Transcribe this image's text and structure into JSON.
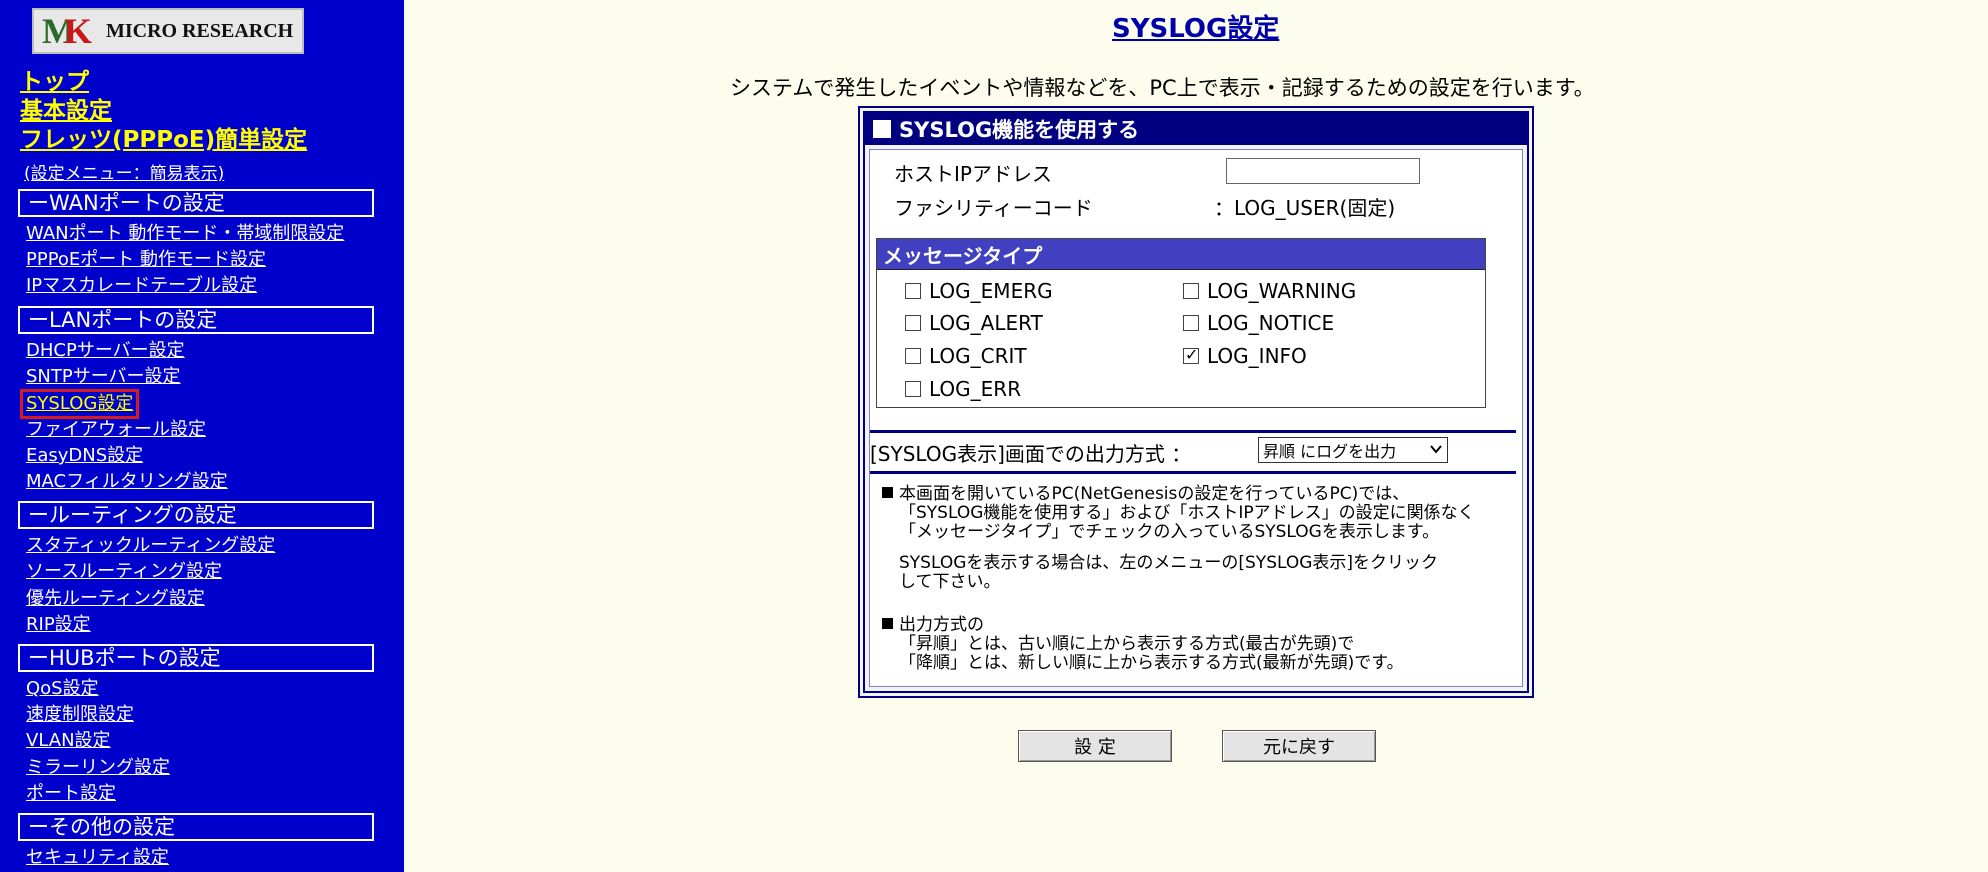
{
  "sidebar": {
    "logo_text": "MICRO RESEARCH",
    "top_links": [
      "トップ",
      "基本設定",
      "フレッツ(PPPoE)簡単設定"
    ],
    "menu_mode": "(設定メニュー：簡易表示)",
    "sections": [
      {
        "title": "ーWANポートの設定",
        "items": [
          "WANポート 動作モード・帯域制限設定",
          "PPPoEポート 動作モード設定",
          "IPマスカレードテーブル設定"
        ]
      },
      {
        "title": "ーLANポートの設定",
        "items": [
          "DHCPサーバー設定",
          "SNTPサーバー設定",
          "SYSLOG設定",
          "ファイアウォール設定",
          "EasyDNS設定",
          "MACフィルタリング設定"
        ]
      },
      {
        "title": "ールーティングの設定",
        "items": [
          "スタティックルーティング設定",
          "ソースルーティング設定",
          "優先ルーティング設定",
          "RIP設定"
        ]
      },
      {
        "title": "ーHUBポートの設定",
        "items": [
          "QoS設定",
          "速度制限設定",
          "VLAN設定",
          "ミラーリング設定",
          "ポート設定"
        ]
      },
      {
        "title": "ーその他の設定",
        "items": [
          "セキュリティ設定"
        ]
      }
    ]
  },
  "main": {
    "title": "SYSLOG設定",
    "description": "システムで発生したイベントや情報などを、PC上で表示・記録するための設定を行います。",
    "panel": {
      "enable_label": "SYSLOG機能を使用する",
      "enable_checked": false,
      "host_ip_label": "ホストIPアドレス",
      "host_ip_value": "",
      "facility_label": "ファシリティーコード",
      "facility_value": "：LOG_USER(固定)",
      "message_type_title": "メッセージタイプ",
      "message_types": [
        {
          "label": "LOG_EMERG",
          "checked": false
        },
        {
          "label": "LOG_ALERT",
          "checked": false
        },
        {
          "label": "LOG_CRIT",
          "checked": false
        },
        {
          "label": "LOG_ERR",
          "checked": false
        },
        {
          "label": "LOG_WARNING",
          "checked": false
        },
        {
          "label": "LOG_NOTICE",
          "checked": false
        },
        {
          "label": "LOG_INFO",
          "checked": true
        }
      ],
      "output_label": "[SYSLOG表示]画面での出力方式 ：",
      "output_selected": "昇順 にログを出力",
      "note1_lines": [
        "本画面を開いているPC(NetGenesisの設定を行っているPC)では、",
        "「SYSLOG機能を使用する」および「ホストIPアドレス」の設定に関係なく",
        "「メッセージタイプ」でチェックの入っているSYSLOGを表示します。"
      ],
      "note1b_lines": [
        "SYSLOGを表示する場合は、左のメニューの[SYSLOG表示]をクリック",
        "して下さい。"
      ],
      "note2_lines": [
        "出力方式の",
        "「昇順」とは、古い順に上から表示する方式(最古が先頭)で",
        "「降順」とは、新しい順に上から表示する方式(最新が先頭)です。"
      ]
    },
    "buttons": {
      "submit": "設 定",
      "reset": "元に戻す"
    }
  }
}
